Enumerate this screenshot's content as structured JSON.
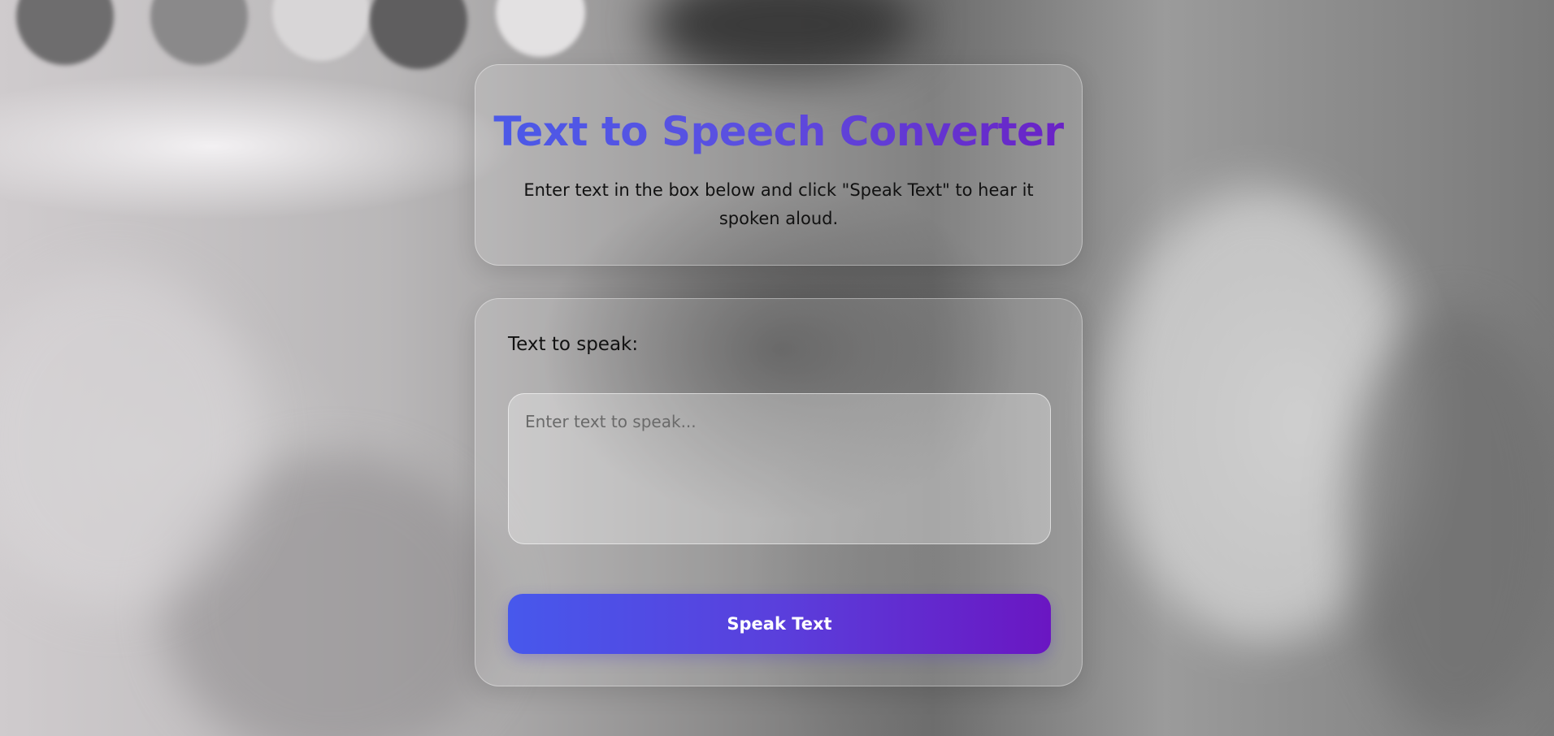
{
  "header": {
    "title": "Text to Speech Converter",
    "subtitle": "Enter text in the box below and click \"Speak Text\" to hear it spoken aloud."
  },
  "form": {
    "label": "Text to speak:",
    "textarea_value": "",
    "textarea_placeholder": "Enter text to speak...",
    "button_label": "Speak Text"
  },
  "colors": {
    "accent_start": "#4758ec",
    "accent_end": "#6a16c2"
  }
}
